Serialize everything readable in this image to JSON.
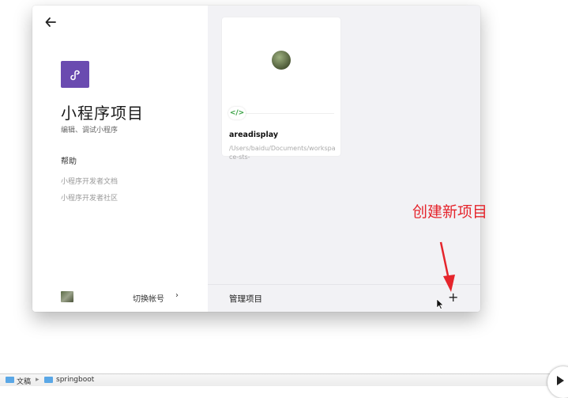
{
  "left_panel": {
    "back_icon": "arrow-left-icon",
    "app_logo_icon": "mini-program-logo",
    "title": "小程序项目",
    "subtitle": "编辑、调试小程序",
    "help": {
      "title": "帮助",
      "links": [
        "小程序开发者文档",
        "小程序开发者社区"
      ]
    },
    "account": {
      "switch_label": "切换帐号",
      "chevron": "›"
    }
  },
  "project_card": {
    "badge": "</>",
    "name": "areadisplay",
    "path": "/Users/baidu/Documents/workspace-sts-"
  },
  "footer": {
    "manage_label": "管理项目",
    "add_label": "+"
  },
  "annotation": {
    "text": "创建新项目",
    "color": "#e5252c"
  },
  "finder_bar": {
    "crumbs": [
      "文稿",
      "springboot"
    ],
    "separator": "▸"
  },
  "colors": {
    "logo_purple": "#6a4bb0",
    "code_green": "#35a040",
    "right_panel_bg": "#f2f2f5"
  }
}
